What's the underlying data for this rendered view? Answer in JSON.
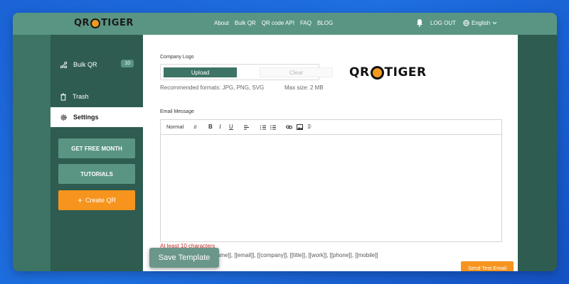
{
  "brand": {
    "logo_left": "QR",
    "logo_right": "TIGER"
  },
  "nav": {
    "about": "About",
    "bulk_qr": "Bulk QR",
    "api": "QR code API",
    "faq": "FAQ",
    "blog": "BLOG"
  },
  "header": {
    "logout": "LOG OUT",
    "language": "English"
  },
  "sidebar": {
    "bulk_qr": "Bulk QR",
    "bulk_qr_count": "10",
    "trash": "Trash",
    "settings": "Settings",
    "get_free_month": "GET FREE MONTH",
    "tutorials": "TUTORIALS",
    "create_qr": "Create QR"
  },
  "company_logo": {
    "label": "Company Logo",
    "upload": "Upload",
    "clear": "Clear",
    "formats": "Recommended formats: JPG, PNG, SVG",
    "max_size": "Max size: 2 MB"
  },
  "email": {
    "label": "Email Message",
    "format_select": "Normal",
    "error": "At least 10 characters",
    "variables": "Available variables: [[name]], [[email]], [[company]], [[title]], [[work]], [[phone]], [[mobile]]",
    "send_test": "Send Test Email"
  },
  "save_template": "Save Template",
  "colors": {
    "accent": "#3d7466",
    "orange": "#f7941d",
    "sidebar": "#2e5c50",
    "error": "#c9362f"
  }
}
